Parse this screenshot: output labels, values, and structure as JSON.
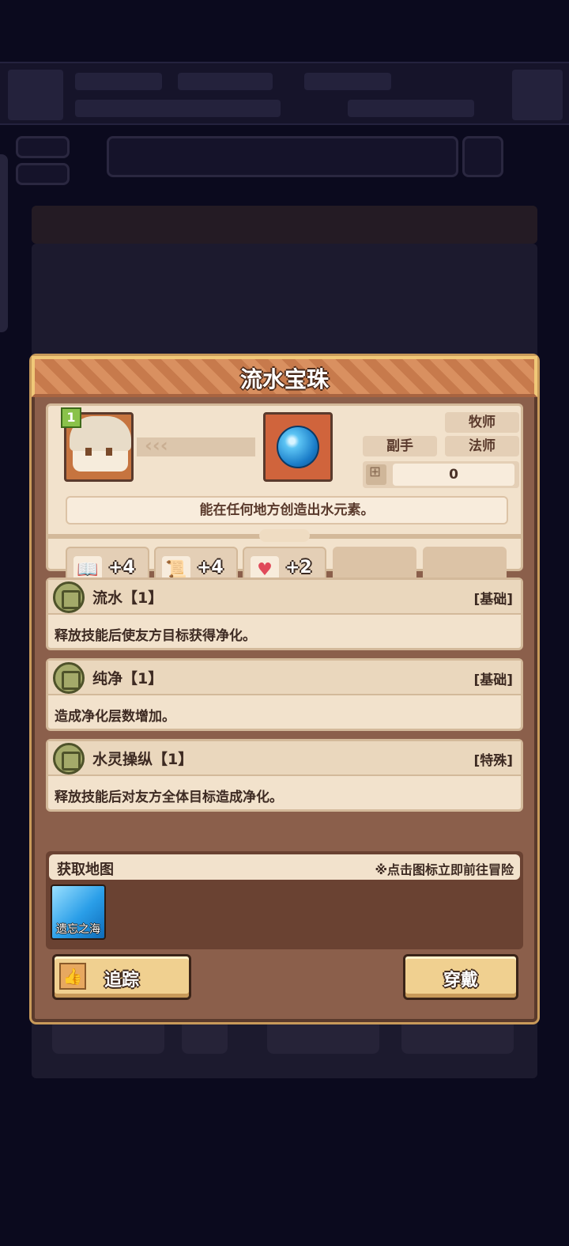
{
  "modal": {
    "title": "流水宝珠",
    "level": "1",
    "roles": {
      "top": "牧师",
      "left": "副手",
      "right": "法师"
    },
    "count": "0",
    "description": "能在任何地方创造出水元素。",
    "stats": [
      {
        "icon": "book-icon",
        "value": "+4"
      },
      {
        "icon": "scroll-icon",
        "value": "+4"
      },
      {
        "icon": "heart-icon",
        "value": "+2"
      }
    ],
    "skills": [
      {
        "name": "流水【1】",
        "type": "[基础]",
        "text": "释放技能后使友方目标获得净化。"
      },
      {
        "name": "纯净【1】",
        "type": "[基础]",
        "text": "造成净化层数增加。"
      },
      {
        "name": "水灵操纵【1】",
        "type": "[特殊]",
        "text": "释放技能后对友方全体目标造成净化。"
      }
    ],
    "map": {
      "title": "获取地图",
      "hint": "※点击图标立即前往冒险",
      "locations": [
        {
          "name": "遗忘之海"
        }
      ]
    },
    "buttons": {
      "track": "追踪",
      "equip": "穿戴"
    }
  }
}
